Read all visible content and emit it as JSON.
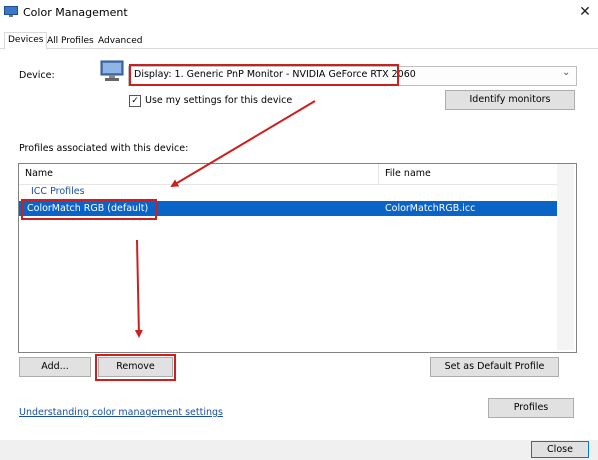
{
  "window": {
    "title": "Color Management",
    "close_glyph": "✕"
  },
  "tabs": [
    {
      "label": "Devices",
      "active": true
    },
    {
      "label": "All Profiles",
      "active": false
    },
    {
      "label": "Advanced",
      "active": false
    }
  ],
  "device": {
    "label": "Device:",
    "selected": "Display: 1. Generic PnP Monitor - NVIDIA GeForce RTX 2060",
    "use_settings_label": "Use my settings for this device",
    "use_settings_checked": true,
    "identify_button": "Identify monitors"
  },
  "profiles": {
    "section_label": "Profiles associated with this device:",
    "columns": [
      "Name",
      "File name"
    ],
    "group_label": "ICC Profiles",
    "rows": [
      {
        "name": "ColorMatch RGB (default)",
        "file": "ColorMatchRGB.icc",
        "selected": true
      }
    ]
  },
  "buttons": {
    "add": "Add...",
    "remove": "Remove",
    "set_default": "Set as Default Profile",
    "profiles": "Profiles",
    "close": "Close"
  },
  "help_link": "Understanding color management settings",
  "colors": {
    "selection": "#0a64c8",
    "annotation_red": "#cc1f1f",
    "link": "#1a4fa3"
  }
}
